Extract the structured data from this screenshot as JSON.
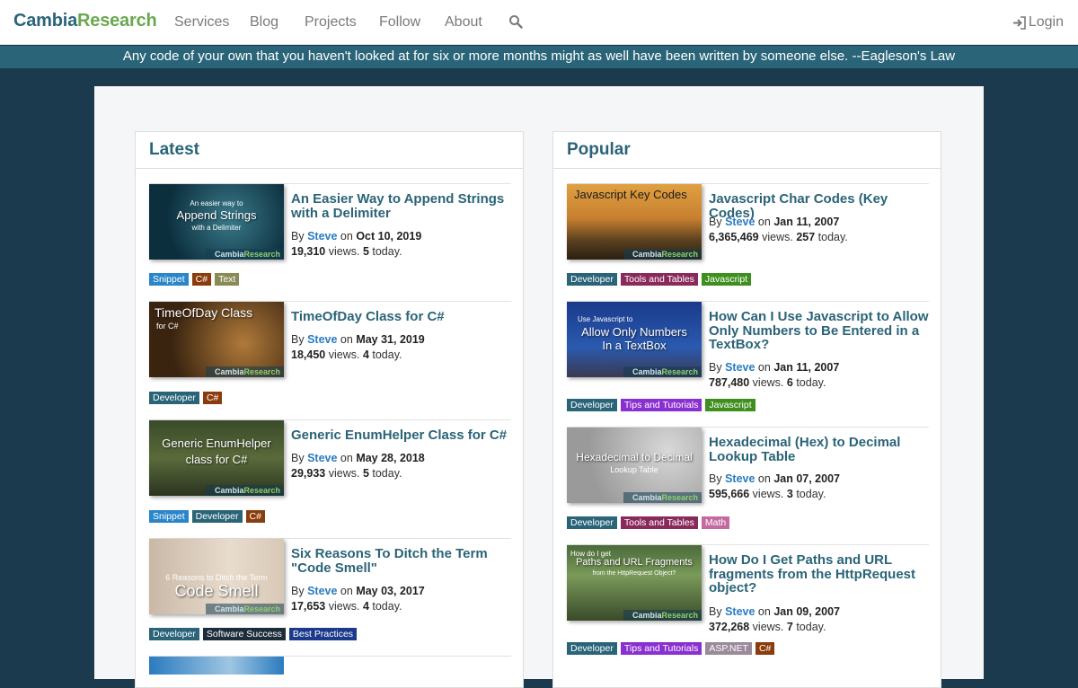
{
  "brand": {
    "part1": "Cambia",
    "part2": "Research"
  },
  "nav": [
    {
      "label": "Services"
    },
    {
      "label": "Blog"
    },
    {
      "label": "Projects"
    },
    {
      "label": "Follow"
    },
    {
      "label": "About"
    }
  ],
  "login_label": "Login",
  "quote": "Any code of your own that you haven't looked at for six or more months might as well have been written by someone else. --Eagleson's Law",
  "labels": {
    "by": "By",
    "on": "on",
    "views": "views.",
    "today": "today."
  },
  "thumb_watermark": {
    "part1": "Cambia",
    "part2": "Research"
  },
  "latest": {
    "title": "Latest",
    "articles": [
      {
        "title": "An Easier Way to Append Strings with a Delimiter",
        "author": "Steve",
        "date": "Oct 10, 2019",
        "views": "19,310",
        "today": "5",
        "thumb": {
          "line1": "An easier way to",
          "line2": "Append Strings",
          "line3": "with a Delimiter"
        },
        "tags": [
          {
            "label": "Snippet"
          },
          {
            "label": "C#"
          },
          {
            "label": "Text"
          }
        ]
      },
      {
        "title": "TimeOfDay Class for C#",
        "author": "Steve",
        "date": "May 31, 2019",
        "views": "18,450",
        "today": "4",
        "thumb": {
          "line1": "",
          "line2": "TimeOfDay Class",
          "line3": "for C#"
        },
        "tags": [
          {
            "label": "Developer"
          },
          {
            "label": "C#"
          }
        ]
      },
      {
        "title": "Generic EnumHelper Class for C#",
        "author": "Steve",
        "date": "May 28, 2018",
        "views": "29,933",
        "today": "5",
        "thumb": {
          "line1": "",
          "line2": "Generic EnumHelper",
          "line3": "class for C#"
        },
        "tags": [
          {
            "label": "Snippet"
          },
          {
            "label": "Developer"
          },
          {
            "label": "C#"
          }
        ]
      },
      {
        "title": "Six Reasons To Ditch the Term \"Code Smell\"",
        "author": "Steve",
        "date": "May 03, 2017",
        "views": "17,653",
        "today": "4",
        "thumb": {
          "line1": "6 Reasons to Ditch the Term",
          "line2": "Code Smell",
          "line3": ""
        },
        "tags": [
          {
            "label": "Developer"
          },
          {
            "label": "Software Success"
          },
          {
            "label": "Best Practices"
          }
        ]
      }
    ]
  },
  "popular": {
    "title": "Popular",
    "articles": [
      {
        "title": "Javascript Char Codes (Key Codes)",
        "author": "Steve",
        "date": "Jan 11, 2007",
        "views": "6,365,469",
        "today": "257",
        "thumb": {
          "line1": "",
          "line2": "Javascript Key Codes",
          "line3": ""
        },
        "tags": [
          {
            "label": "Developer"
          },
          {
            "label": "Tools and Tables"
          },
          {
            "label": "Javascript"
          }
        ]
      },
      {
        "title": "How Can I Use Javascript to Allow Only Numbers to Be Entered in a TextBox?",
        "author": "Steve",
        "date": "Jan 11, 2007",
        "views": "787,480",
        "today": "6",
        "thumb": {
          "line1": "Use Javascript to",
          "line2": "Allow Only Numbers",
          "line3": "In a TextBox"
        },
        "tags": [
          {
            "label": "Developer"
          },
          {
            "label": "Tips and Tutorials"
          },
          {
            "label": "Javascript"
          }
        ]
      },
      {
        "title": "Hexadecimal (Hex) to Decimal Lookup Table",
        "author": "Steve",
        "date": "Jan 07, 2007",
        "views": "595,666",
        "today": "3",
        "thumb": {
          "line1": "",
          "line2": "Hexadecimal to Decimal",
          "line3": "Lookup Table"
        },
        "tags": [
          {
            "label": "Developer"
          },
          {
            "label": "Tools and Tables"
          },
          {
            "label": "Math"
          }
        ]
      },
      {
        "title": "How Do I Get Paths and URL fragments from the HttpRequest object?",
        "author": "Steve",
        "date": "Jan 09, 2007",
        "views": "372,268",
        "today": "7",
        "thumb": {
          "line1": "How do I get",
          "line2": "Paths and URL Fragments",
          "line3": "from the HttpRequest Object?"
        },
        "tags": [
          {
            "label": "Developer"
          },
          {
            "label": "Tips and Tutorials"
          },
          {
            "label": "ASP.NET"
          },
          {
            "label": "C#"
          }
        ]
      }
    ]
  },
  "colors": {
    "brand_primary": "#2a6478",
    "brand_accent": "#6aa84f",
    "page_bg": "#1b3a4d",
    "quote_bar": "#2a6478",
    "tag_snippet": "#2a86c8",
    "tag_csharp": "#8a3c0c",
    "tag_text": "#8a8a55",
    "tag_developer": "#2a6478",
    "tag_software_success": "#1e2d3a",
    "tag_best_practices": "#1c3a8c",
    "tag_tools_tables": "#8a2a5a",
    "tag_javascript": "#3f8f1f",
    "tag_tips_tutorials": "#8a2fd0",
    "tag_math": "#c46aa0",
    "tag_aspnet": "#9a8a9a"
  }
}
